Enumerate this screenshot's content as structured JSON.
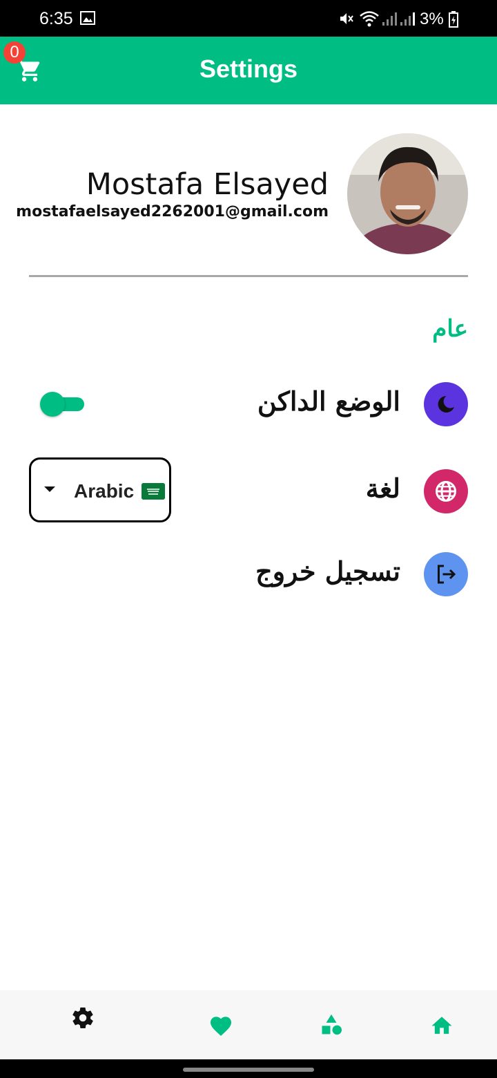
{
  "status_bar": {
    "time": "6:35",
    "battery": "3%"
  },
  "app_bar": {
    "title": "Settings",
    "cart_badge": "0"
  },
  "profile": {
    "name": "Mostafa Elsayed",
    "email": "mostafaelsayed2262001@gmail.com"
  },
  "section": {
    "general": "عام"
  },
  "settings": {
    "dark_mode_label": "الوضع الداكن",
    "dark_mode_on": true,
    "language_label": "لغة",
    "language_value": "Arabic",
    "logout_label": "تسجيل خروج"
  },
  "colors": {
    "accent": "#00bd83",
    "dark_mode_icon": "#5b34e0",
    "language_icon": "#d2286a",
    "logout_icon": "#5f93f0"
  },
  "bottom_nav": [
    "settings-icon",
    "heart-icon",
    "categories-icon",
    "home-icon"
  ]
}
